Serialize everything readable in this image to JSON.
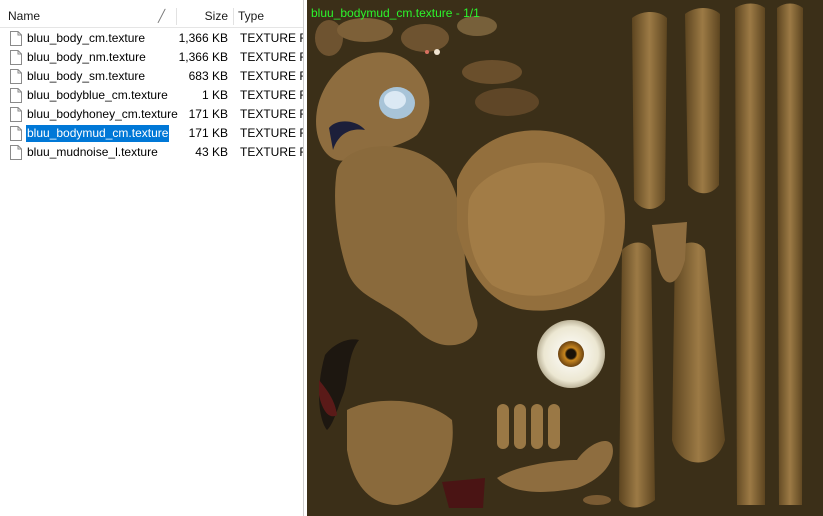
{
  "columns": {
    "name": "Name",
    "size": "Size",
    "type": "Type"
  },
  "files": [
    {
      "name": "bluu_body_cm.texture",
      "size": "1,366 KB",
      "type": "TEXTURE Fi"
    },
    {
      "name": "bluu_body_nm.texture",
      "size": "1,366 KB",
      "type": "TEXTURE Fi"
    },
    {
      "name": "bluu_body_sm.texture",
      "size": "683 KB",
      "type": "TEXTURE Fi"
    },
    {
      "name": "bluu_bodyblue_cm.texture",
      "size": "1 KB",
      "type": "TEXTURE Fi"
    },
    {
      "name": "bluu_bodyhoney_cm.texture",
      "size": "171 KB",
      "type": "TEXTURE Fi"
    },
    {
      "name": "bluu_bodymud_cm.texture",
      "size": "171 KB",
      "type": "TEXTURE Fi"
    },
    {
      "name": "bluu_mudnoise_l.texture",
      "size": "43 KB",
      "type": "TEXTURE Fi"
    }
  ],
  "selected_file": "bluu_bodymud_cm.texture",
  "preview": {
    "title": "bluu_bodymud_cm.texture - 1/1"
  },
  "colors": {
    "selection": "#0078d7",
    "preview_title": "#2cf52c",
    "texture_background": "#3b2f18"
  }
}
